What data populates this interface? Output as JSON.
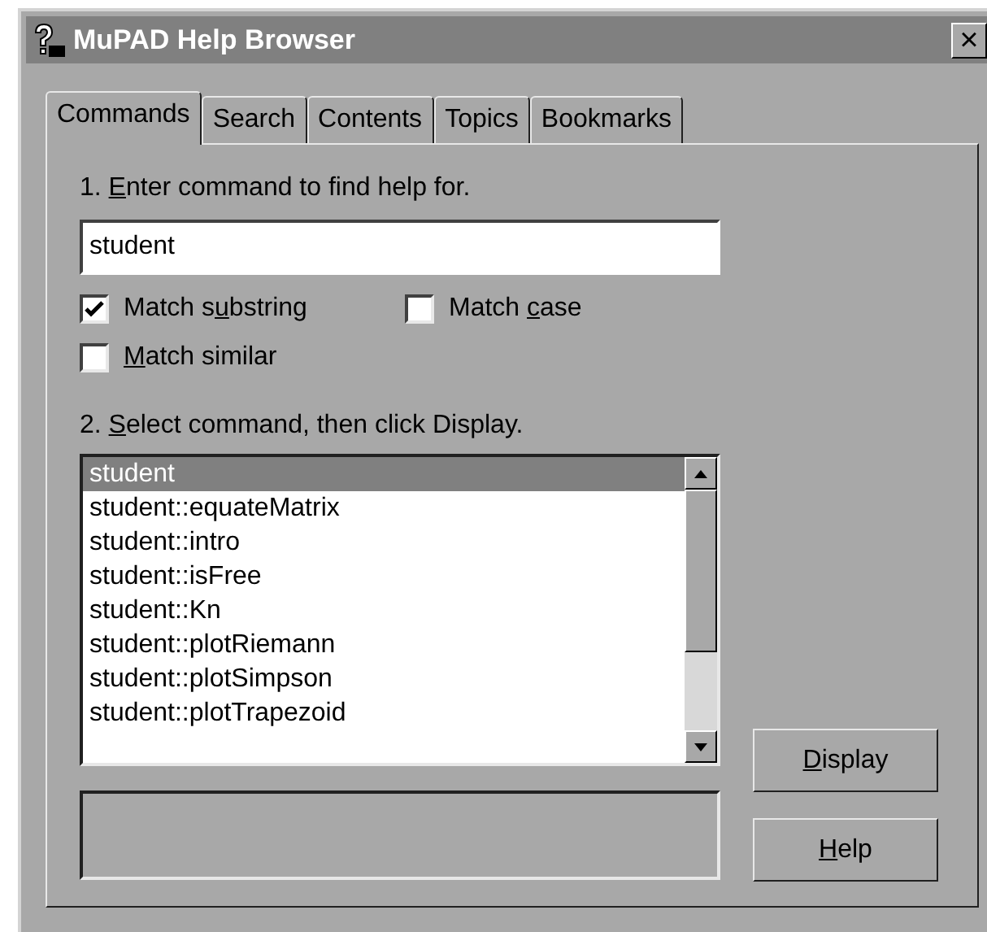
{
  "window": {
    "title": "MuPAD Help Browser",
    "close": "×"
  },
  "tabs": [
    {
      "label": "Commands",
      "selected": true
    },
    {
      "label": "Search",
      "selected": false
    },
    {
      "label": "Contents",
      "selected": false
    },
    {
      "label": "Topics",
      "selected": false
    },
    {
      "label": "Bookmarks",
      "selected": false
    }
  ],
  "step1": {
    "before": "1. ",
    "key": "E",
    "after": "nter command to find help for."
  },
  "command_field": {
    "value": "student"
  },
  "options": [
    {
      "before": "Match s",
      "key": "u",
      "after": "bstring",
      "checked": true
    },
    {
      "before": "Match ",
      "key": "c",
      "after": "ase",
      "checked": false
    },
    {
      "key": "M",
      "after": "atch similar",
      "checked": false
    }
  ],
  "step2": {
    "before": "2. ",
    "key": "S",
    "after": "elect command, then click Display."
  },
  "commands": [
    {
      "label": "student",
      "selected": true
    },
    {
      "label": "student::equateMatrix",
      "selected": false
    },
    {
      "label": "student::intro",
      "selected": false
    },
    {
      "label": "student::isFree",
      "selected": false
    },
    {
      "label": "student::Kn",
      "selected": false
    },
    {
      "label": "student::plotRiemann",
      "selected": false
    },
    {
      "label": "student::plotSimpson",
      "selected": false
    },
    {
      "label": "student::plotTrapezoid",
      "selected": false
    }
  ],
  "buttons": [
    {
      "key": "D",
      "after": "isplay"
    },
    {
      "key": "H",
      "after": "elp"
    }
  ]
}
